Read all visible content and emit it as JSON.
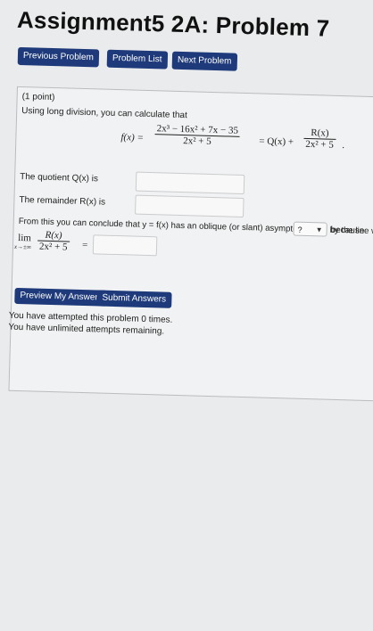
{
  "title": "Assignment5 2A: Problem 7",
  "nav": {
    "previous": "Previous Problem",
    "list": "Problem List",
    "next": "Next Problem"
  },
  "problem": {
    "points": "(1 point)",
    "intro": "Using long division, you can calculate that",
    "f_label": "f(x) =",
    "numerator": "2x³ − 16x² + 7x − 35",
    "denominator": "2x² + 5",
    "equals_q": "= Q(x) +",
    "r_num": "R(x)",
    "r_den": "2x² + 5",
    "period": ".",
    "quotient_label": "The quotient Q(x) is",
    "quotient_value": "",
    "remainder_label": "The remainder R(x) is",
    "remainder_value": "",
    "conclude_text": "From this you can conclude that y = f(x) has an oblique (or slant) asymptote given by the line with equation y =",
    "select_value": "?",
    "because": "because",
    "lim_label": "lim",
    "lim_sub": "x→±∞",
    "lim_num": "R(x)",
    "lim_den": "2x² + 5",
    "lim_equals": "=",
    "lim_value": ""
  },
  "actions": {
    "preview": "Preview My Answers",
    "submit": "Submit Answers"
  },
  "status": {
    "attempted": "You have attempted this problem 0 times.",
    "unlimited": "You have unlimited attempts remaining."
  },
  "colors": {
    "button": "#1e3a7a",
    "background": "#e9ebec"
  }
}
